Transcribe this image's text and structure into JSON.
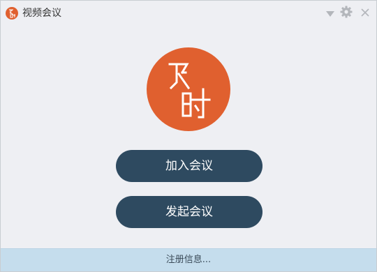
{
  "window": {
    "title": "视频会议",
    "controls": {
      "dropdown_icon": "triangle-down-icon",
      "settings_icon": "gear-icon",
      "close_icon": "close-icon"
    }
  },
  "logo": {
    "text": "及时",
    "color": "#e0602f"
  },
  "actions": {
    "join_label": "加入会议",
    "start_label": "发起会议",
    "button_color": "#2e4a60"
  },
  "footer": {
    "register_label": "注册信息..."
  },
  "colors": {
    "background": "#eeeff3",
    "footer_bg": "#c5dded"
  }
}
